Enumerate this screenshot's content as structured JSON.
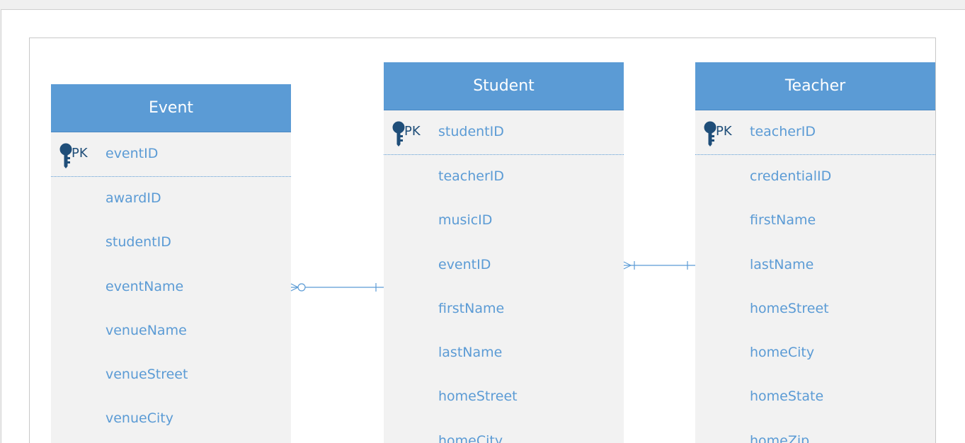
{
  "entities": {
    "event": {
      "title": "Event",
      "pk_label": "PK",
      "pk_field": "eventID",
      "fields": [
        "awardID",
        "studentID",
        "eventName",
        "venueName",
        "venueStreet",
        "venueCity"
      ]
    },
    "student": {
      "title": "Student",
      "pk_label": "PK",
      "pk_field": "studentID",
      "fields": [
        "teacherID",
        "musicID",
        "eventID",
        "firstName",
        "lastName",
        "homeStreet",
        "homeCity"
      ]
    },
    "teacher": {
      "title": "Teacher",
      "pk_label": "PK",
      "pk_field": "teacherID",
      "fields": [
        "credentialID",
        "firstName",
        "lastName",
        "homeStreet",
        "homeCity",
        "homeState",
        "homeZip"
      ]
    }
  },
  "relationships": [
    {
      "from": "Event",
      "to": "Student",
      "from_cardinality": "zero-or-many",
      "to_cardinality": "one"
    },
    {
      "from": "Student",
      "to": "Teacher",
      "from_cardinality": "many",
      "to_cardinality": "one-and-only-one"
    }
  ],
  "colors": {
    "header": "#5b9bd5",
    "field_text": "#5b9bd5",
    "pk_text": "#1f4e79",
    "body": "#f2f2f2"
  }
}
